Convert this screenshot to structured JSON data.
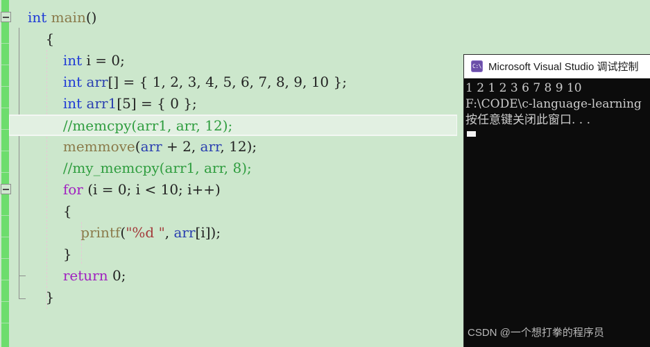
{
  "editor": {
    "background_color": "#cce7cc",
    "change_bar_color": "#6ddd6d",
    "current_line_index": 5,
    "lines": [
      {
        "indent": 0,
        "tokens": [
          {
            "t": "int ",
            "c": "kw"
          },
          {
            "t": "main",
            "c": "fn"
          },
          {
            "t": "()",
            "c": "pun"
          }
        ]
      },
      {
        "indent": 1,
        "tokens": [
          {
            "t": "{",
            "c": "pun"
          }
        ]
      },
      {
        "indent": 2,
        "tokens": [
          {
            "t": "int",
            "c": "kw"
          },
          {
            "t": " i = 0;",
            "c": "pun"
          }
        ]
      },
      {
        "indent": 2,
        "tokens": [
          {
            "t": "int",
            "c": "kw"
          },
          {
            "t": " ",
            "c": "pun"
          },
          {
            "t": "arr",
            "c": "var"
          },
          {
            "t": "[] = { 1, 2, 3, 4, 5, 6, 7, 8, 9, 10 };",
            "c": "pun"
          }
        ]
      },
      {
        "indent": 2,
        "tokens": [
          {
            "t": "int",
            "c": "kw"
          },
          {
            "t": " ",
            "c": "pun"
          },
          {
            "t": "arr1",
            "c": "var"
          },
          {
            "t": "[5] = { 0 };",
            "c": "pun"
          }
        ]
      },
      {
        "indent": 2,
        "tokens": [
          {
            "t": "//memcpy(arr1, arr, 12);",
            "c": "cmt"
          }
        ]
      },
      {
        "indent": 2,
        "tokens": [
          {
            "t": "memmove",
            "c": "fn"
          },
          {
            "t": "(",
            "c": "pun"
          },
          {
            "t": "arr",
            "c": "var"
          },
          {
            "t": " + 2, ",
            "c": "pun"
          },
          {
            "t": "arr",
            "c": "var"
          },
          {
            "t": ", 12);",
            "c": "pun"
          }
        ]
      },
      {
        "indent": 2,
        "tokens": [
          {
            "t": "//my_memcpy(arr1, arr, 8);",
            "c": "cmt"
          }
        ]
      },
      {
        "indent": 2,
        "tokens": [
          {
            "t": "for",
            "c": "kw2"
          },
          {
            "t": " (i = 0; i < 10; i++)",
            "c": "pun"
          }
        ]
      },
      {
        "indent": 2,
        "tokens": [
          {
            "t": "{",
            "c": "pun"
          }
        ]
      },
      {
        "indent": 3,
        "tokens": [
          {
            "t": "printf",
            "c": "fn"
          },
          {
            "t": "(",
            "c": "pun"
          },
          {
            "t": "\"%d \"",
            "c": "str"
          },
          {
            "t": ", ",
            "c": "pun"
          },
          {
            "t": "arr",
            "c": "var"
          },
          {
            "t": "[i]);",
            "c": "pun"
          }
        ]
      },
      {
        "indent": 2,
        "tokens": [
          {
            "t": "}",
            "c": "pun"
          }
        ]
      },
      {
        "indent": 2,
        "tokens": [
          {
            "t": "return",
            "c": "kw2"
          },
          {
            "t": " 0;",
            "c": "pun"
          }
        ]
      },
      {
        "indent": 1,
        "tokens": [
          {
            "t": "}",
            "c": "pun"
          }
        ]
      }
    ],
    "fold_markers": [
      {
        "line": 0,
        "state": "expanded"
      },
      {
        "line": 8,
        "state": "expanded"
      }
    ]
  },
  "console": {
    "title": "Microsoft Visual Studio 调试控制",
    "icon_name": "console-app-icon",
    "icon_glyph": "C:\\",
    "background_color": "#0c0c0c",
    "text_color": "#cccccc",
    "output_lines": [
      "1 2 1 2 3 6 7 8 9 10",
      "F:\\CODE\\c-language-learning",
      "按任意键关闭此窗口. . ."
    ]
  },
  "watermark": {
    "text": "CSDN @一个想打拳的程序员"
  }
}
